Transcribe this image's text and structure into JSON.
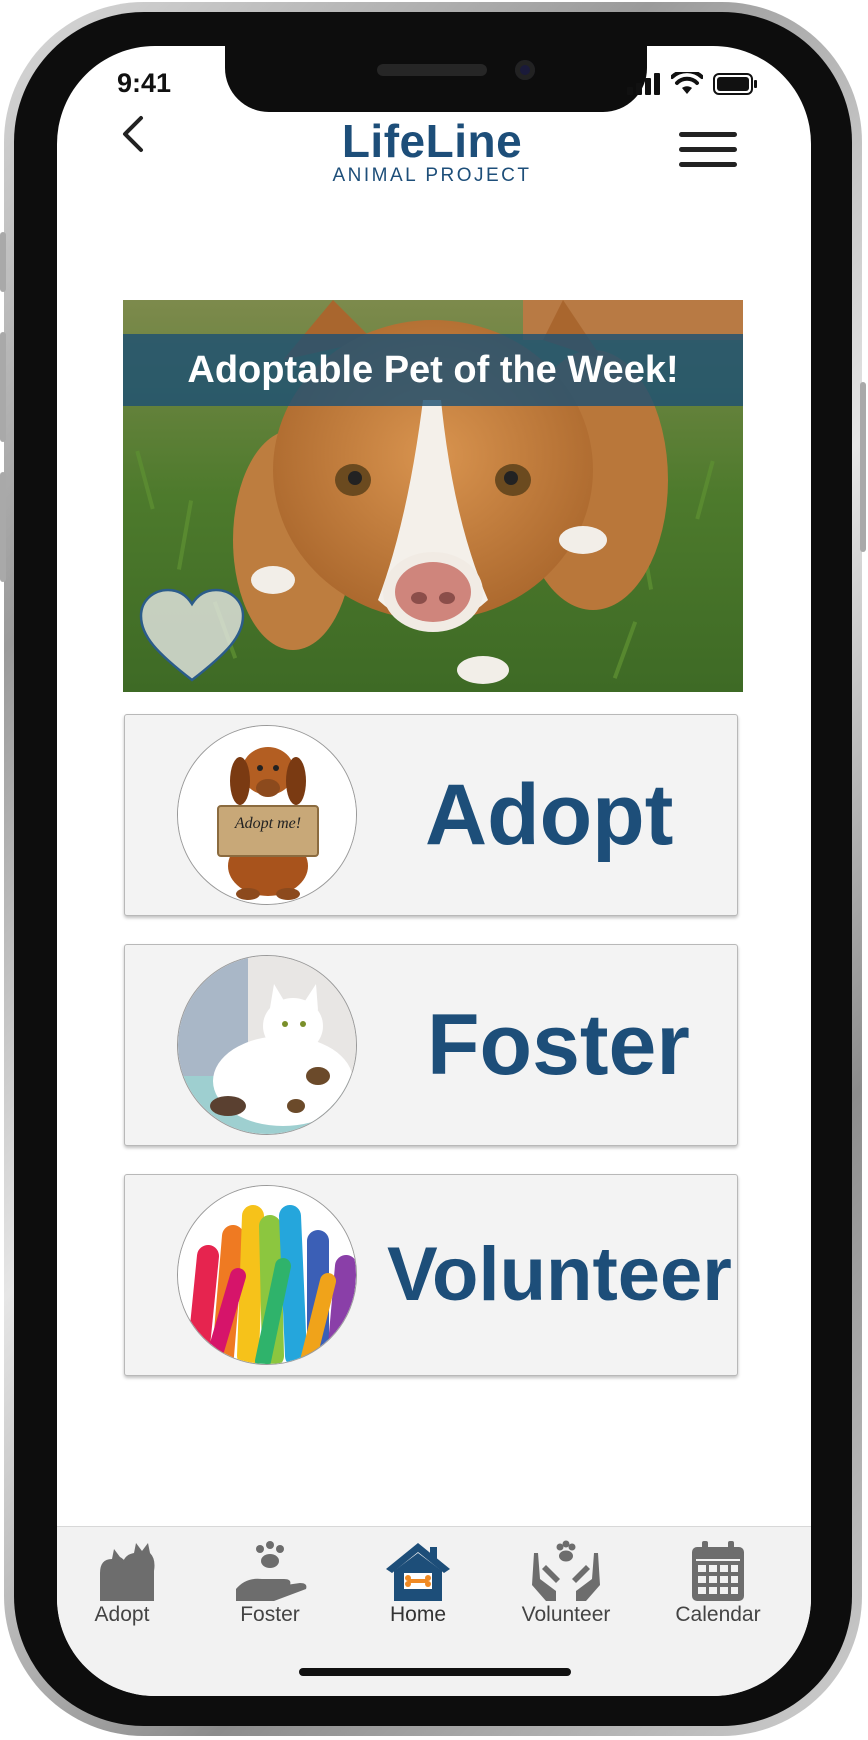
{
  "status_bar": {
    "time": "9:41"
  },
  "header": {
    "logo_title": "LifeLine",
    "logo_subtitle": "ANIMAL PROJECT"
  },
  "featured_pet": {
    "banner": "Adoptable Pet of the Week!"
  },
  "actions": [
    {
      "label": "Adopt",
      "image_sign": "Adopt me!"
    },
    {
      "label": "Foster"
    },
    {
      "label": "Volunteer"
    }
  ],
  "tabbar": {
    "items": [
      {
        "label": "Adopt",
        "icon": "pets-icon"
      },
      {
        "label": "Foster",
        "icon": "paw-hand-icon"
      },
      {
        "label": "Home",
        "icon": "home-icon"
      },
      {
        "label": "Volunteer",
        "icon": "hands-paw-icon"
      },
      {
        "label": "Calendar",
        "icon": "calendar-icon"
      }
    ],
    "active": "Home"
  },
  "colors": {
    "brand": "#1d4e79",
    "banner": "#1e5073",
    "tabbar_bg": "#f2f2f2",
    "home_accent": "#f08a24"
  }
}
